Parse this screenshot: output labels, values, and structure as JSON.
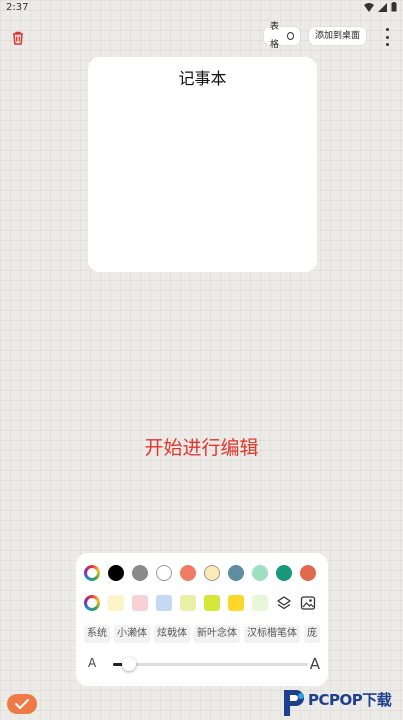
{
  "status_bar": {
    "time": "2:37"
  },
  "top_bar": {
    "delete_icon": "trash-icon",
    "table_label": "表格",
    "add_to_desktop_label": "添加到桌面",
    "more_icon": "more-vertical-icon"
  },
  "note_card": {
    "title": "记事本"
  },
  "hint": "开始进行编辑",
  "palette": {
    "colors": [
      "#000000",
      "#8a8a8a",
      "#ffffff",
      "#ef7b63",
      "#fbeab5",
      "#5f8ca0",
      "#9de0c1",
      "#16987a",
      "#e0684b"
    ],
    "background_colors": [
      "#fbf5c8",
      "#f8d1d6",
      "#c6d9f2",
      "#eaf0a5",
      "#d5e83a",
      "#fbd829",
      "#e6f6d6"
    ],
    "layers_icon": "layers-icon",
    "image_icon": "image-icon"
  },
  "fonts": [
    "系统",
    "小濑体",
    "炫戟体",
    "新叶念体",
    "汉标楷笔体",
    "庞"
  ],
  "text_size": {
    "small_label": "A",
    "large_label": "A",
    "level": 0.08
  },
  "confirm_icon": "check-icon",
  "watermark": {
    "brand": "PCPOP下载",
    "icon": "pcpop-logo-icon"
  },
  "colors": {
    "accent": "#ef7a45",
    "hint": "#e0362b"
  }
}
